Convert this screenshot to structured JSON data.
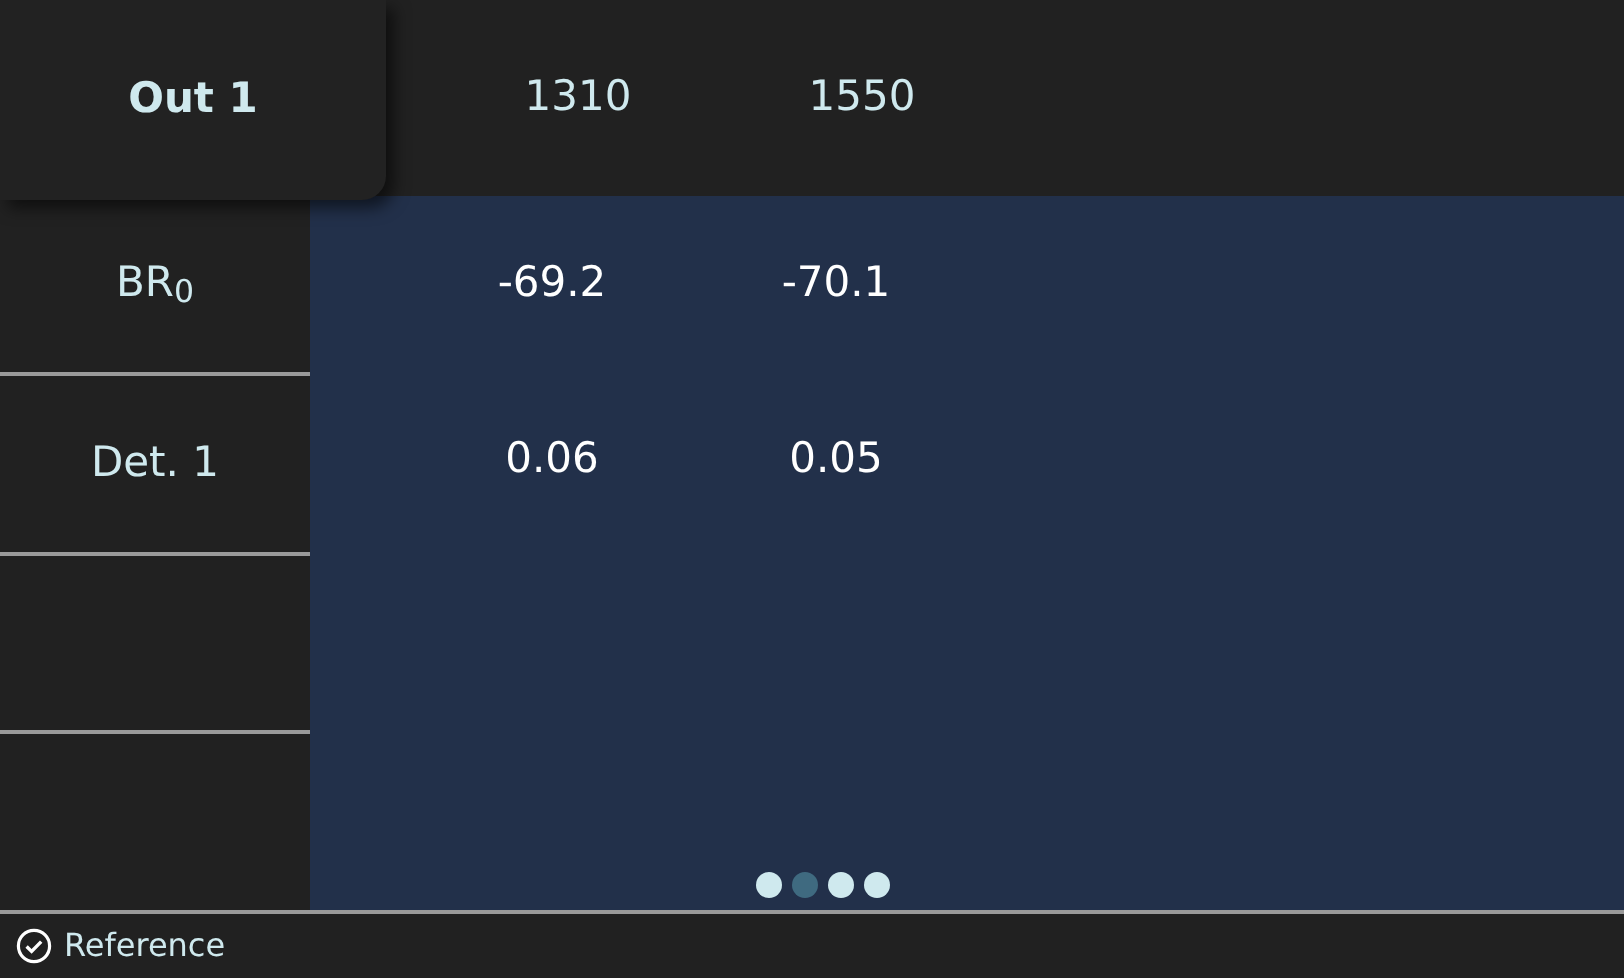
{
  "output_tab": {
    "label": "Out 1",
    "selected": true
  },
  "columns": [
    "1310",
    "1550"
  ],
  "rows": [
    {
      "label": "BR$_{0}$",
      "values": [
        "-69.2",
        "-70.1"
      ]
    },
    {
      "label": "Det. 1",
      "values": [
        "0.06",
        "0.05"
      ]
    },
    {
      "label": "",
      "values": []
    },
    {
      "label": "",
      "values": []
    }
  ],
  "pages": [
    {
      "selected": false
    },
    {
      "selected": true
    },
    {
      "selected": false
    },
    {
      "selected": false
    }
  ],
  "status_bar": {
    "text": "Reference"
  }
}
